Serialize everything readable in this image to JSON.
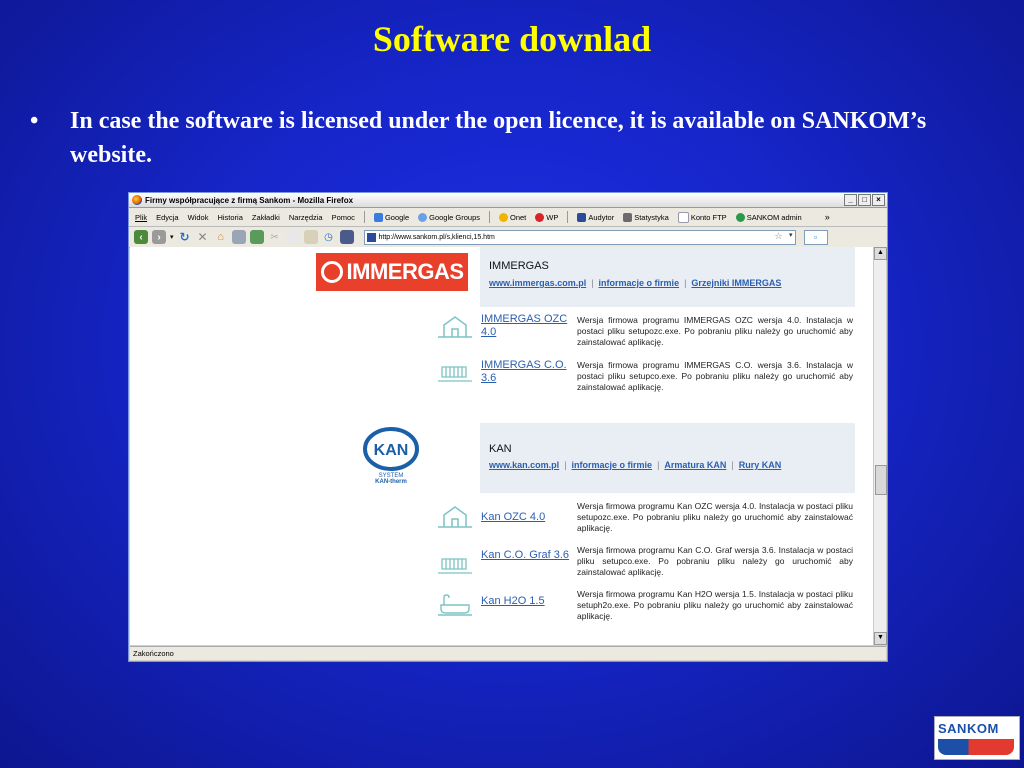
{
  "slide": {
    "title": "Software downlad",
    "bullet": "•",
    "bullet_text": "In case the software is licensed under the open licence, it is available on SANKOM’s website."
  },
  "browser": {
    "window_title": "Firmy współpracujące z firmą Sankom - Mozilla Firefox",
    "menu": [
      "Plik",
      "Edycja",
      "Widok",
      "Historia",
      "Zakładki",
      "Narzędzia",
      "Pomoc"
    ],
    "bookmarks": [
      {
        "label": "Google",
        "icon": "google-icon",
        "color": "#3b7be0"
      },
      {
        "label": "Google Groups",
        "icon": "groups-icon",
        "color": "#6aa0e6"
      },
      {
        "label": "Onet",
        "icon": "onet-icon",
        "color": "#f2b400"
      },
      {
        "label": "WP",
        "icon": "wp-icon",
        "color": "#d8232a"
      },
      {
        "label": "Audytor",
        "icon": "audytor-icon",
        "color": "#2a4a9a"
      },
      {
        "label": "Statystyka",
        "icon": "stats-icon",
        "color": "#6b6b6b"
      },
      {
        "label": "Konto FTP",
        "icon": "page-icon",
        "color": "#ffffff"
      },
      {
        "label": "SANKOM admin",
        "icon": "sankom-icon",
        "color": "#2a9a4a"
      }
    ],
    "overflow": "»",
    "url": "http://www.sankom.pl/s,klienci,15.htm",
    "status": "Zakończono",
    "window_buttons": [
      "_",
      "□",
      "×"
    ]
  },
  "page": {
    "immergas": {
      "logo_text": "IMMERGAS",
      "name": "IMMERGAS",
      "links": [
        "www.immergas.com.pl",
        "informacje o firmie",
        "Grzejniki IMMERGAS"
      ],
      "products": [
        {
          "name": "IMMERGAS OZC 4.0",
          "desc": "Wersja firmowa programu IMMERGAS OZC wersja 4.0. Instalacja w postaci pliku setupozc.exe. Po pobraniu pliku należy go uruchomić aby zainstalować aplikację."
        },
        {
          "name": "IMMERGAS C.O. 3.6",
          "desc": "Wersja firmowa programu IMMERGAS C.O. wersja 3.6. Instalacja w postaci pliku setupco.exe. Po pobraniu pliku należy go uruchomić aby zainstalować aplikację."
        }
      ]
    },
    "kan": {
      "logo_text": "KAN",
      "logo_sub1": "SYSTEM",
      "logo_sub2": "KAN-therm",
      "name": "KAN",
      "links": [
        "www.kan.com.pl",
        "informacje o firmie",
        "Armatura KAN",
        "Rury KAN"
      ],
      "products": [
        {
          "name": "Kan OZC 4.0",
          "desc": "Wersja firmowa programu Kan OZC wersja 4.0. Instalacja w postaci pliku setupozc.exe. Po pobraniu pliku należy go uruchomić aby zainstalować aplikację."
        },
        {
          "name": "Kan C.O. Graf 3.6",
          "desc": "Wersja firmowa programu Kan C.O. Graf wersja 3.6. Instalacja w postaci pliku setupco.exe. Po pobraniu pliku należy go uruchomić aby zainstalować aplikację."
        },
        {
          "name": "Kan H2O 1.5",
          "desc": "Wersja firmowa programu Kan H2O wersja 1.5. Instalacja w postaci pliku setuph2o.exe. Po pobraniu pliku należy go uruchomić aby zainstalować aplikację."
        }
      ]
    }
  },
  "footer_logo": {
    "text": "SANKOM"
  },
  "colors": {
    "slide_bg": "#1626c9",
    "title": "#ffff00",
    "link": "#2a5fb0",
    "immergas_red": "#e8402a"
  }
}
